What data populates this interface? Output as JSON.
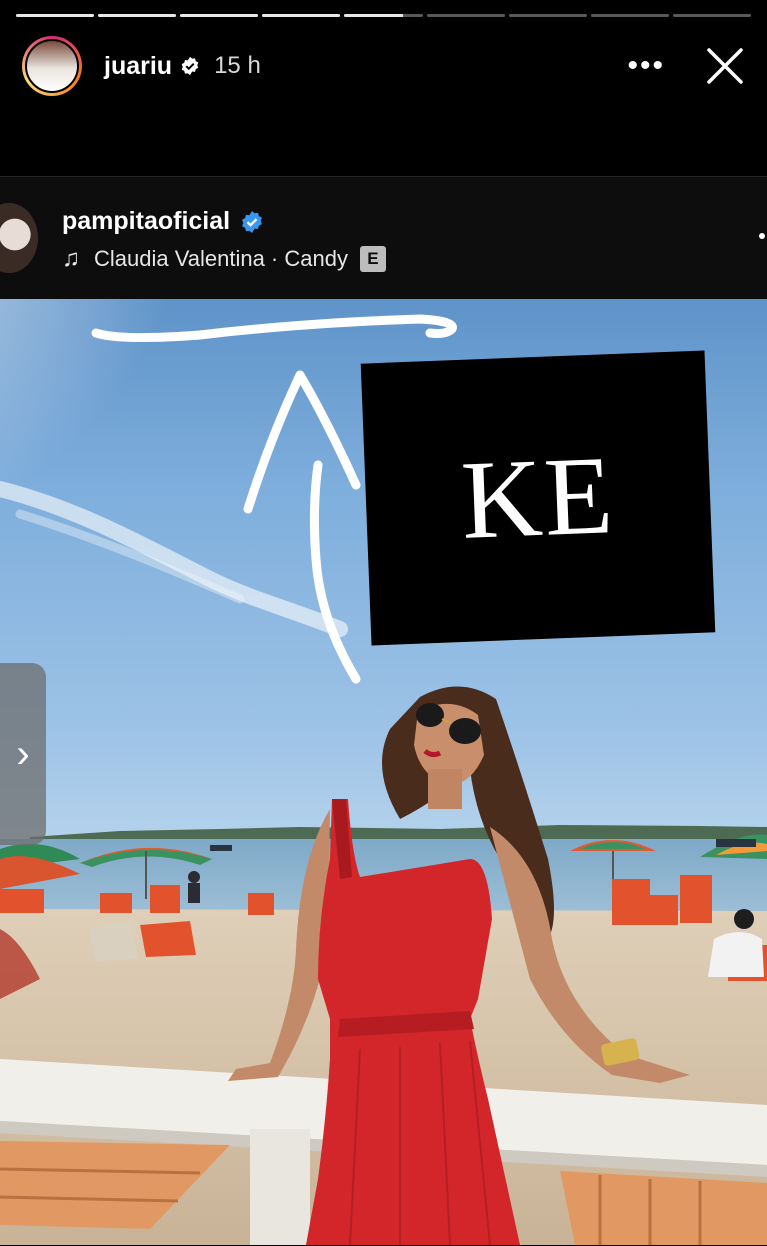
{
  "story": {
    "progress": [
      1,
      1,
      1,
      1,
      0.75,
      0,
      0,
      0,
      0
    ],
    "username": "juariu",
    "time": "15 h",
    "more_icon": "more-horizontal-icon",
    "close_icon": "close-icon"
  },
  "post": {
    "username": "pampitaoficial",
    "music": "Claudia Valentina · Candy",
    "explicit_label": "E",
    "sticker_text": "KE",
    "next_glyph": "›"
  },
  "colors": {
    "verified_blue": "#3897f0",
    "background": "#000000",
    "dress_red": "#d2262a"
  }
}
